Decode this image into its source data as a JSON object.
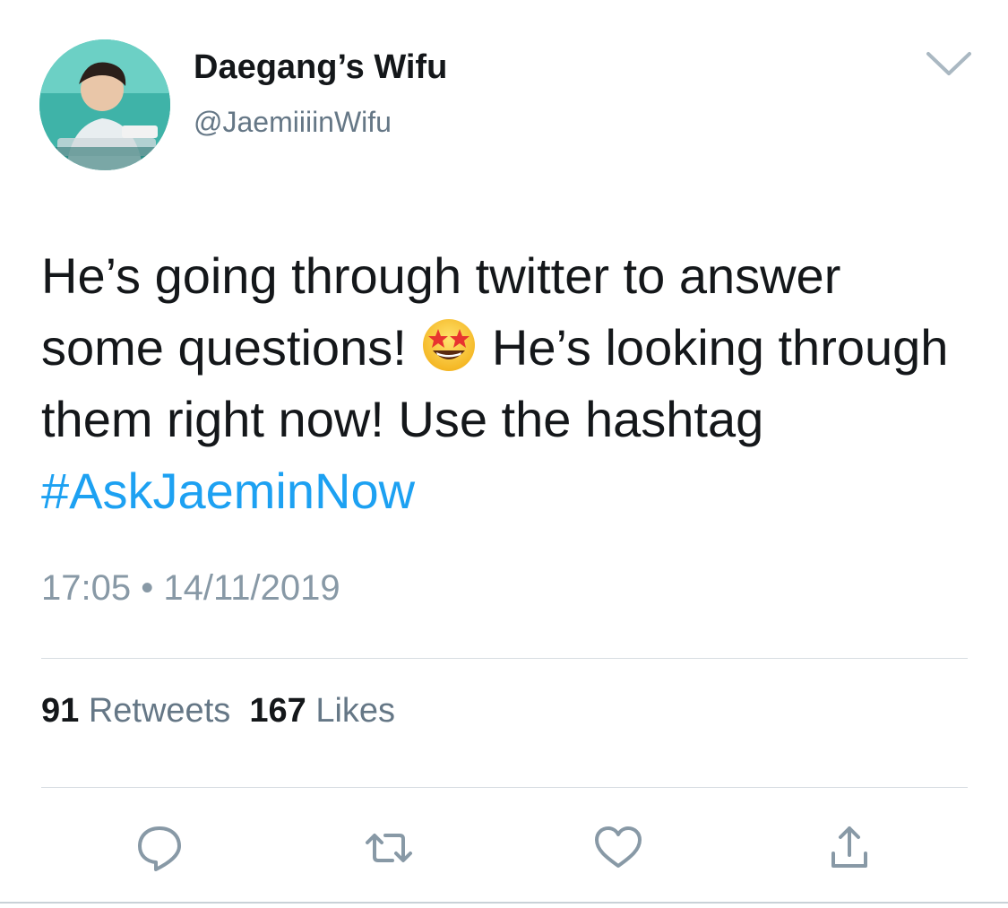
{
  "user": {
    "display_name": "Daegang’s Wifu",
    "handle": "@JaemiiiinWifu",
    "avatar_icon": "profile-photo"
  },
  "tweet": {
    "text_part1": "He’s going through twitter to answer some questions! ",
    "emoji": "star-struck-emoji",
    "text_part2": " He’s looking through them right now! Use the hashtag ",
    "hashtag": "#AskJaeminNow",
    "time": "17:05",
    "separator": "•",
    "date": "14/11/2019"
  },
  "stats": {
    "retweets_count": "91",
    "retweets_label": "Retweets",
    "likes_count": "167",
    "likes_label": "Likes"
  },
  "actions": {
    "reply_icon": "reply-icon",
    "retweet_icon": "retweet-icon",
    "like_icon": "heart-icon",
    "share_icon": "share-icon"
  },
  "colors": {
    "text": "#14171a",
    "secondary": "#657786",
    "meta": "#8899a6",
    "link": "#1da1f2",
    "icon": "#8899a6",
    "divider": "#d7dde2"
  }
}
